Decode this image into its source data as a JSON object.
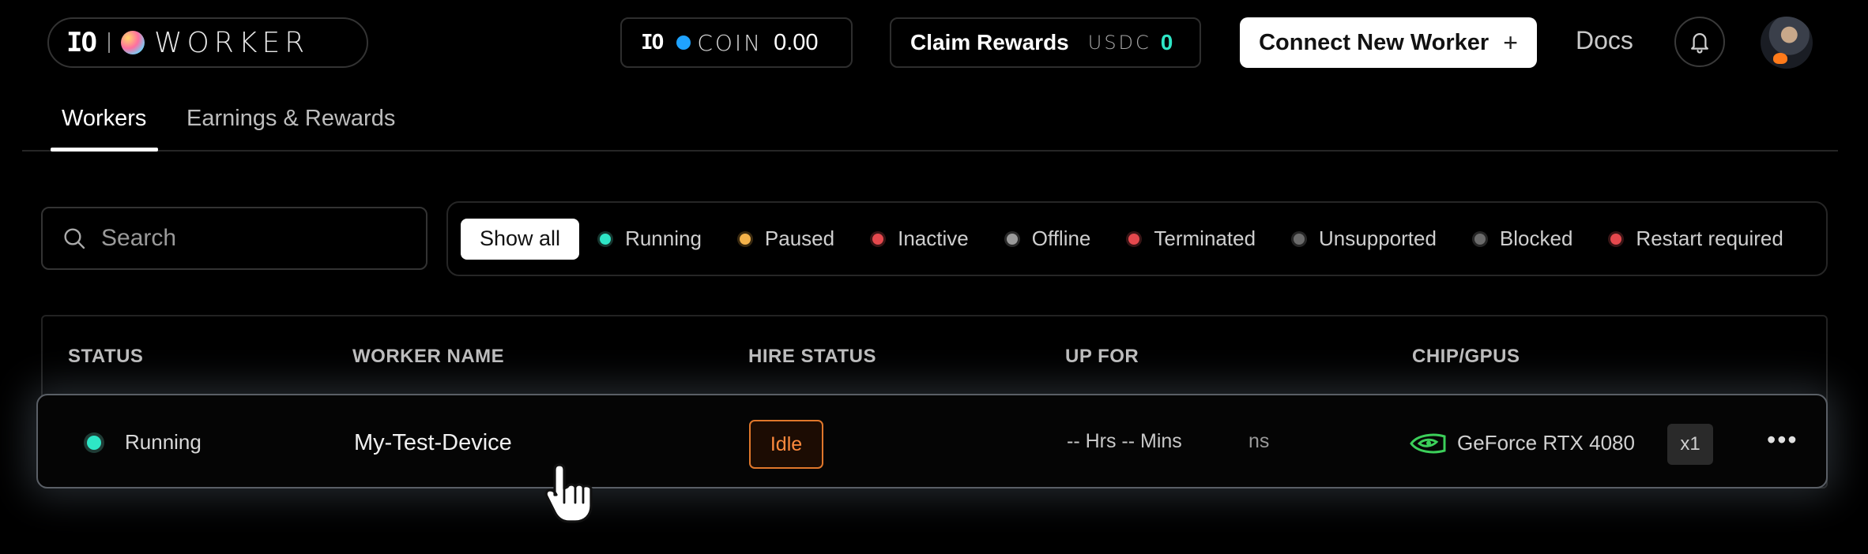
{
  "header": {
    "logo": {
      "mark": "IO",
      "wordmark": "WORKER"
    },
    "coin": {
      "mark": "IO",
      "label": "COIN",
      "value": "0.00"
    },
    "claim": {
      "label": "Claim Rewards",
      "currency": "USDC",
      "value": "0"
    },
    "connect_button": {
      "label": "Connect New Worker",
      "icon": "plus-icon"
    },
    "docs_link": "Docs",
    "notifications_icon": "bell-icon",
    "avatar": "avatar"
  },
  "tabs": [
    {
      "label": "Workers",
      "active": true
    },
    {
      "label": "Earnings & Rewards",
      "active": false
    }
  ],
  "search": {
    "placeholder": "Search",
    "icon": "search-icon"
  },
  "filters": {
    "show_all": "Show all",
    "chips": [
      {
        "label": "Running",
        "color": "#2ee6c6"
      },
      {
        "label": "Paused",
        "color": "#f4b24a"
      },
      {
        "label": "Inactive",
        "color": "#e5484d"
      },
      {
        "label": "Offline",
        "color": "#9a9a9a"
      },
      {
        "label": "Terminated",
        "color": "#e5484d"
      },
      {
        "label": "Unsupported",
        "color": "#6b6b6b"
      },
      {
        "label": "Blocked",
        "color": "#6b6b6b"
      },
      {
        "label": "Restart required",
        "color": "#e5484d"
      }
    ]
  },
  "table": {
    "columns": [
      "STATUS",
      "WORKER NAME",
      "HIRE STATUS",
      "UP FOR",
      "CHIP/GPUS"
    ],
    "rows": [
      {
        "status": "Running",
        "status_color": "#2ee6c6",
        "worker_name": "My-Test-Device",
        "hire_status": "Idle",
        "up_for": "-- Hrs -- Mins",
        "up_for_ghost": "ns",
        "gpu_icon": "nvidia-icon",
        "gpu": "GeForce RTX 4080",
        "gpu_count": "x1",
        "more_icon": "more-icon"
      }
    ]
  },
  "colors": {
    "accent_teal": "#2ee6c6",
    "hire_orange": "#ff8a3d",
    "nvidia_green": "#76b900"
  }
}
